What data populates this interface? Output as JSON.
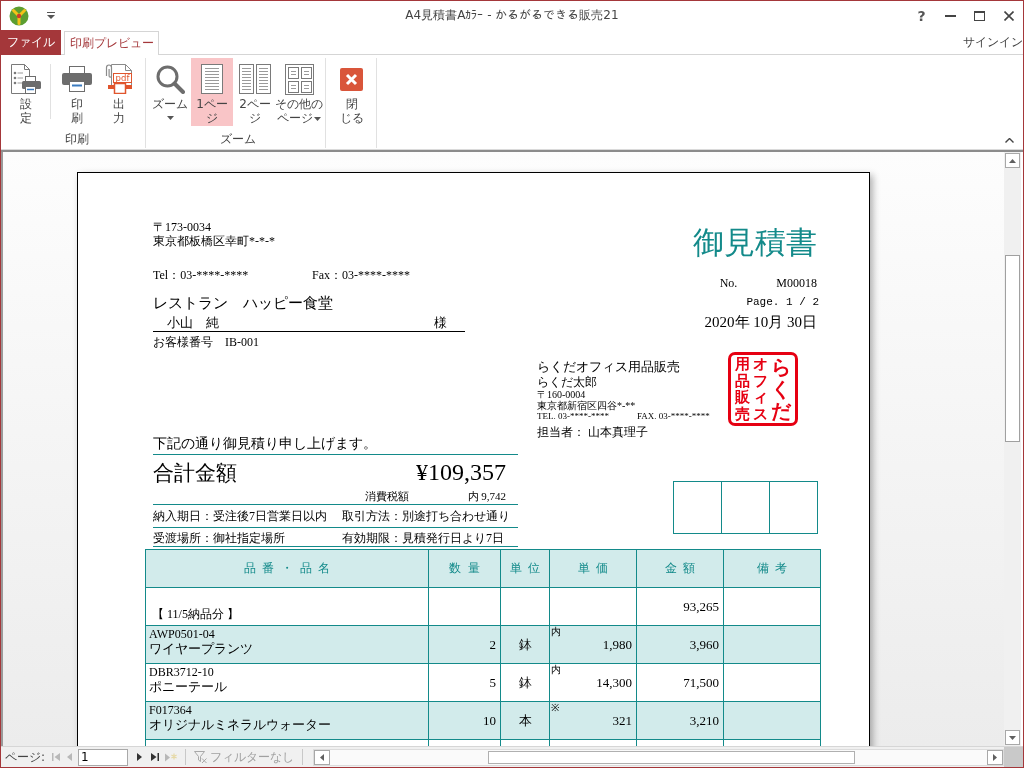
{
  "window": {
    "title": "A4見積書Aｶﾗｰ - かるがるできる販売21",
    "help": "?"
  },
  "ribbon": {
    "tabs": [
      {
        "label": "ファイル",
        "kind": "file",
        "selected": false
      },
      {
        "label": "印刷プレビュー",
        "kind": "tab",
        "selected": true
      }
    ],
    "account": "サインイン",
    "groups": [
      {
        "label": "印刷",
        "buttons": [
          {
            "kind": "setup",
            "lines": [
              "設",
              "定"
            ],
            "dropdown": false,
            "selected": false
          },
          {
            "kind": "print",
            "lines": [
              "印",
              "刷"
            ],
            "dropdown": false,
            "selected": false
          },
          {
            "kind": "pdf",
            "lines": [
              "出",
              "力"
            ],
            "icon_text": "pdf",
            "dropdown": false,
            "selected": false
          }
        ]
      },
      {
        "label": "ズーム",
        "buttons": [
          {
            "kind": "zoom",
            "lines": [
              "ズーム"
            ],
            "dropdown": true,
            "selected": false
          },
          {
            "kind": "one_page",
            "lines": [
              "1ペー",
              "ジ"
            ],
            "dropdown": false,
            "selected": true
          },
          {
            "kind": "two_pages",
            "lines": [
              "2ペー",
              "ジ"
            ],
            "dropdown": false,
            "selected": false
          },
          {
            "kind": "more_pages",
            "lines": [
              "その他の",
              "ページ"
            ],
            "dropdown": true,
            "selected": false
          }
        ]
      },
      {
        "buttons": [
          {
            "kind": "close",
            "lines": [
              "閉",
              "じる"
            ],
            "dropdown": false,
            "selected": false
          }
        ]
      }
    ]
  },
  "document": {
    "customer": {
      "postal_code": "〒173-0034",
      "address": "東京都板橋区幸町*-*-*",
      "tel": "Tel：03-****-****",
      "fax": "Fax：03-****-****",
      "company": "レストラン　ハッピー食堂",
      "contact": "小山　純",
      "honorific": "様",
      "number_label": "お客様番号",
      "number": "IB-001"
    },
    "title": "御見積書",
    "quote_number_label": "No.",
    "quote_number": "M00018",
    "page": "Page. 1 / 2",
    "date": "2020年 10月 30日",
    "issuer": {
      "company": "らくだオフィス用品販売",
      "person": "らくだ太郎",
      "postal_code": "〒160-0004",
      "address": "東京都新宿区四谷*-**",
      "tel": "TEL. 03-****-****",
      "fax": "FAX. 03-****-****",
      "staff": "担当者： 山本真理子",
      "seal": [
        "用品販売",
        "オフィス",
        "らくだ"
      ]
    },
    "greeting": "下記の通り御見積り申し上げます。",
    "total_label": "合計金額",
    "total": "¥109,357",
    "tax_label": "消費税額",
    "tax": "内 9,742",
    "terms": [
      [
        "納入期日：受注後7日営業日以内",
        "取引方法：別途打ち合わせ通り"
      ],
      [
        "受渡場所：御社指定場所",
        "有効期限：見積発行日より7日"
      ]
    ],
    "table": {
      "columns": [
        "品番・品名",
        "数量",
        "単位",
        "単価",
        "金額",
        "備考"
      ],
      "rows": [
        {
          "kind": "group",
          "label": "【 11/5納品分 】",
          "amount": "93,265"
        },
        {
          "kind": "item",
          "code": "AWP0501-04",
          "name": "ワイヤープランツ",
          "quantity": "2",
          "unit": "鉢",
          "tax_mark": "内",
          "unit_price": "1,980",
          "amount": "3,960"
        },
        {
          "kind": "item",
          "code": "DBR3712-10",
          "name": "ポニーテール",
          "quantity": "5",
          "unit": "鉢",
          "tax_mark": "内",
          "unit_price": "14,300",
          "amount": "71,500"
        },
        {
          "kind": "item",
          "code": "F017364",
          "name": "オリジナルミネラルウォーター",
          "quantity": "10",
          "unit": "本",
          "tax_mark": "※",
          "unit_price": "321",
          "amount": "3,210"
        }
      ]
    }
  },
  "status_bar": {
    "page_label": "ページ:",
    "page": "1",
    "nav": [
      {
        "kind": "first",
        "disabled": true
      },
      {
        "kind": "previous",
        "disabled": true
      },
      {
        "kind": "next",
        "disabled": false
      },
      {
        "kind": "last",
        "disabled": false
      },
      {
        "kind": "new",
        "disabled": true
      }
    ],
    "filter": {
      "label": "フィルターなし",
      "disabled": true
    }
  }
}
